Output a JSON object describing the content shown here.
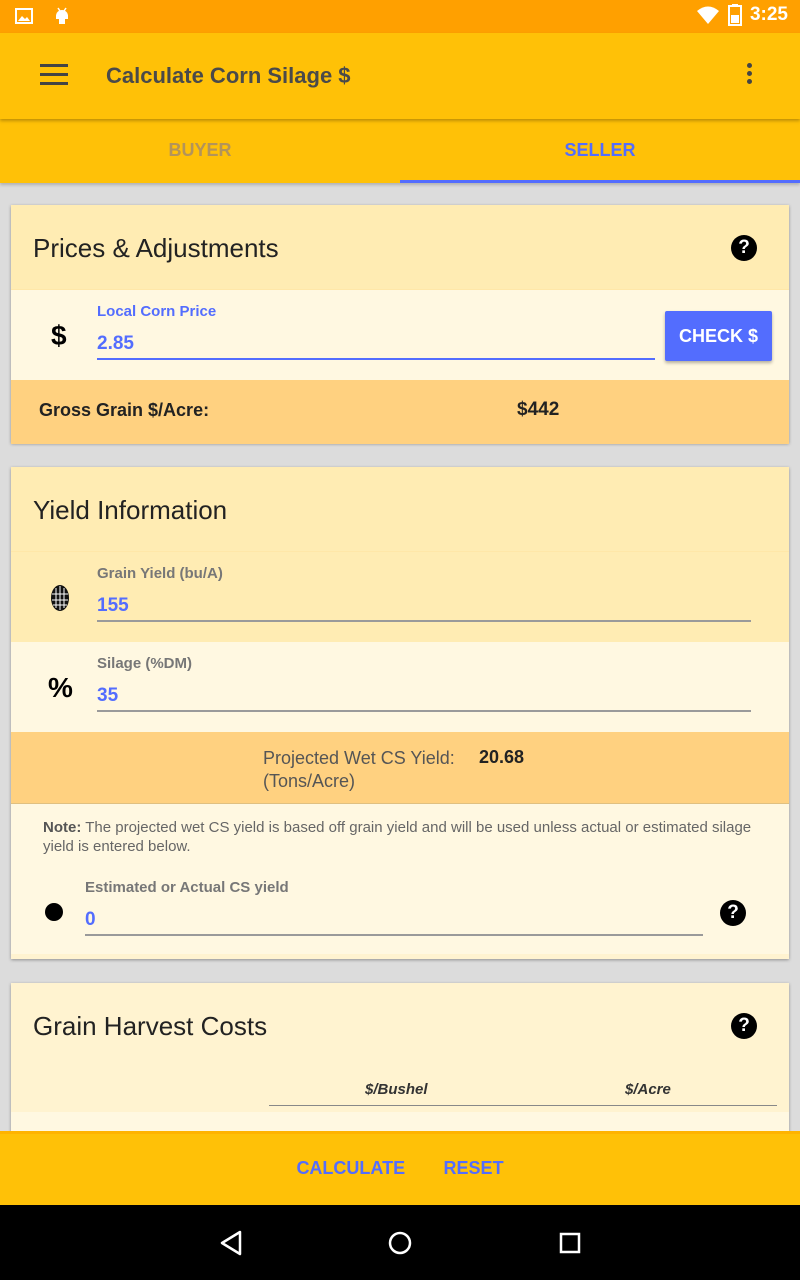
{
  "status_bar": {
    "time": "3:25"
  },
  "app_bar": {
    "title": "Calculate Corn Silage $"
  },
  "tabs": [
    {
      "label": "BUYER",
      "active": false
    },
    {
      "label": "SELLER",
      "active": true
    }
  ],
  "prices_card": {
    "title": "Prices & Adjustments",
    "currency_symbol": "$",
    "corn_price_label": "Local Corn Price",
    "corn_price_value": "2.85",
    "check_button": "CHECK $",
    "gross_label": "Gross Grain $/Acre:",
    "gross_value": "$442"
  },
  "yield_card": {
    "title": "Yield Information",
    "grain_yield_label": "Grain Yield (bu/A)",
    "grain_yield_value": "155",
    "silage_symbol": "%",
    "silage_label": "Silage (%DM)",
    "silage_value": "35",
    "projected_label": "Projected Wet CS Yield:",
    "projected_unit": "(Tons/Acre)",
    "projected_value": "20.68",
    "note_bold": "Note:",
    "note_text": " The projected wet CS yield is based off grain yield and will be used unless actual or estimated silage yield is entered below.",
    "estimated_label": "Estimated or Actual CS yield",
    "estimated_value": "0"
  },
  "harvest_card": {
    "title": "Grain Harvest Costs",
    "col_bushel": "$/Bushel",
    "col_acre": "$/Acre"
  },
  "bottom_actions": {
    "calculate": "CALCULATE",
    "reset": "RESET"
  },
  "colors": {
    "primary": "#ffc107",
    "status": "#ffa000",
    "accent": "#536dfe",
    "summary": "#ffd180"
  },
  "icons": [
    "image-icon",
    "android-icon",
    "wifi-icon",
    "battery-icon",
    "menu-icon",
    "overflow-menu-icon",
    "help-icon",
    "corn-icon",
    "dot-icon",
    "back-icon",
    "home-icon",
    "recents-icon"
  ]
}
